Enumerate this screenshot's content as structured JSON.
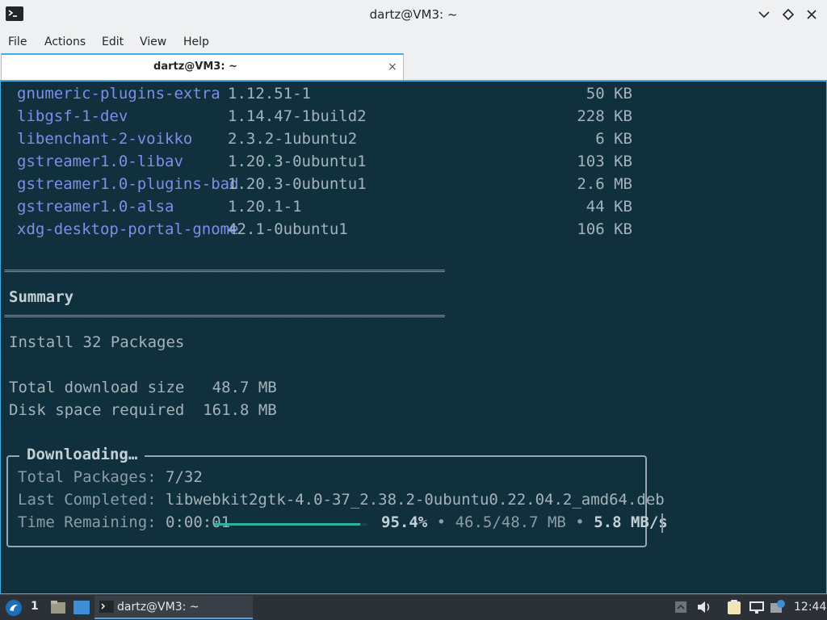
{
  "window": {
    "title": "dartz@VM3: ~"
  },
  "menubar": {
    "items": [
      "File",
      "Actions",
      "Edit",
      "View",
      "Help"
    ]
  },
  "tab": {
    "label": "dartz@VM3: ~",
    "close": "×"
  },
  "terminal": {
    "packages": [
      {
        "name": "gnumeric-plugins-extra",
        "version": "1.12.51-1",
        "size": "50 KB"
      },
      {
        "name": "libgsf-1-dev",
        "version": "1.14.47-1build2",
        "size": "228 KB"
      },
      {
        "name": "libenchant-2-voikko",
        "version": "2.3.2-1ubuntu2",
        "size": "6 KB"
      },
      {
        "name": "gstreamer1.0-libav",
        "version": "1.20.3-0ubuntu1",
        "size": "103 KB"
      },
      {
        "name": "gstreamer1.0-plugins-bad",
        "version": "1.20.3-0ubuntu1",
        "size": "2.6 MB"
      },
      {
        "name": "gstreamer1.0-alsa",
        "version": "1.20.1-1",
        "size": "44 KB"
      },
      {
        "name": "xdg-desktop-portal-gnome",
        "version": "42.1-0ubuntu1",
        "size": "106 KB"
      }
    ],
    "rule": "=================================================================================================",
    "summary_heading": "Summary",
    "install_line": "Install 32 Packages",
    "download_size_line": "Total download size   48.7 MB",
    "disk_space_line": "Disk space required  161.8 MB",
    "download": {
      "title": "Downloading…",
      "total_label": "Total Packages:",
      "total_value": "7/32",
      "last_label": "Last Completed:",
      "last_value": "libwebkit2gtk-4.0-37_2.38.2-0ubuntu0.22.04.2_amd64.deb",
      "remaining_label": "Time Remaining:",
      "remaining_value": "0:00:01",
      "progress_fraction": 0.954,
      "percent": "95.4%",
      "separator": "•",
      "transferred": "46.5/48.7 MB",
      "speed": "5.8 MB/s"
    }
  },
  "taskbar": {
    "workspace": "1",
    "task_label": "dartz@VM3: ~",
    "clock": "12:44"
  },
  "colors": {
    "terminal_bg": "#10303d",
    "package_name": "#7f8ee6",
    "progress": "#2bb0a1",
    "accent": "#3daee9"
  }
}
